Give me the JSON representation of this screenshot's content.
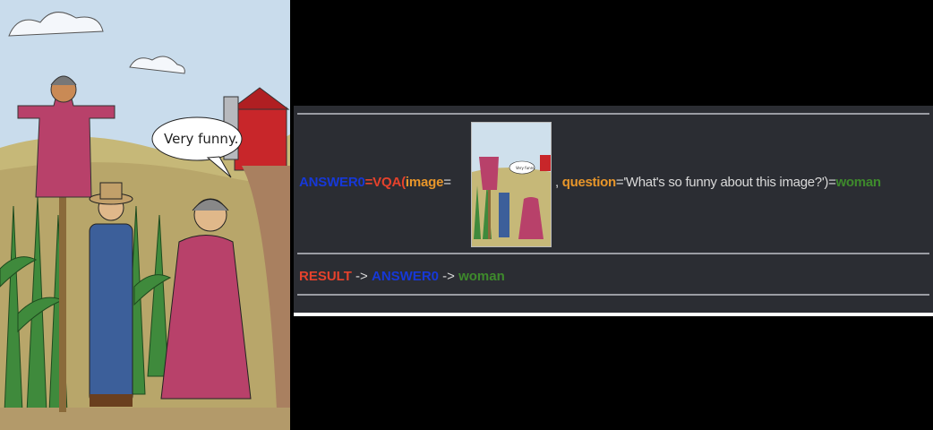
{
  "cartoon": {
    "speech": "Very funny."
  },
  "thumbnail": {
    "speech": "Very funny."
  },
  "program": {
    "var": "ANSWER0",
    "eq1": "=",
    "func": "VQA(",
    "image_kw": "image",
    "eq2": "=",
    "comma": ",",
    "question_kw": "question",
    "eq3": "=",
    "question_val": "'What's so funny about this image?')",
    "eq4": "=",
    "answer": "woman"
  },
  "result": {
    "label": "RESULT",
    "arrow1": " -> ",
    "var": "ANSWER0",
    "arrow2": " -> ",
    "answer": "woman"
  },
  "colors": {
    "var": "#1638d8",
    "func": "#e5422c",
    "keyword": "#e8962a",
    "answer": "#3e8a2c",
    "panel": "#2b2d33"
  }
}
